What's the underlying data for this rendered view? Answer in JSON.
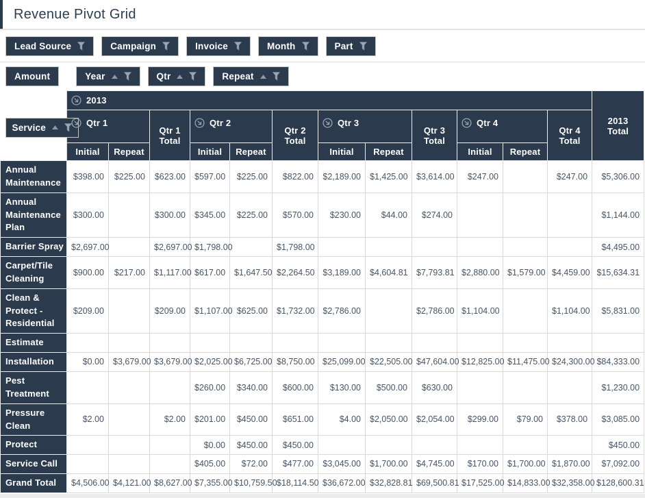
{
  "page": {
    "title": "Revenue Pivot Grid"
  },
  "filter_area": {
    "fields": [
      {
        "label": "Lead Source",
        "icon": "filter-funnel"
      },
      {
        "label": "Campaign",
        "icon": "filter-funnel"
      },
      {
        "label": "Invoice",
        "icon": "filter-funnel"
      },
      {
        "label": "Month",
        "icon": "filter-funnel"
      },
      {
        "label": "Part",
        "icon": "filter-funnel"
      }
    ]
  },
  "data_area": {
    "field": {
      "label": "Amount"
    }
  },
  "column_area": {
    "fields": [
      {
        "label": "Year",
        "sort": "asc",
        "icon": "filter-funnel"
      },
      {
        "label": "Qtr",
        "sort": "asc",
        "icon": "filter-funnel"
      },
      {
        "label": "Repeat",
        "sort": "asc",
        "icon": "filter-funnel"
      }
    ]
  },
  "row_area": {
    "field": {
      "label": "Service",
      "sort": "asc",
      "icon": "filter-funnel"
    }
  },
  "grid": {
    "year": {
      "label": "2013",
      "total_label": "2013 Total",
      "expanded": true
    },
    "quarters": [
      {
        "label": "Qtr 1",
        "total_label": "Qtr 1 Total",
        "expanded": true
      },
      {
        "label": "Qtr 2",
        "total_label": "Qtr 2 Total",
        "expanded": true
      },
      {
        "label": "Qtr 3",
        "total_label": "Qtr 3 Total",
        "expanded": true
      },
      {
        "label": "Qtr 4",
        "total_label": "Qtr 4 Total",
        "expanded": true
      }
    ],
    "subcolumns": [
      "Initial",
      "Repeat"
    ],
    "rows": [
      {
        "label": "Annual Maintenance",
        "values": [
          "$398.00",
          "$225.00",
          "$623.00",
          "$597.00",
          "$225.00",
          "$822.00",
          "$2,189.00",
          "$1,425.00",
          "$3,614.00",
          "$247.00",
          "",
          "$247.00",
          "$5,306.00"
        ]
      },
      {
        "label": "Annual Maintenance Plan",
        "values": [
          "$300.00",
          "",
          "$300.00",
          "$345.00",
          "$225.00",
          "$570.00",
          "$230.00",
          "$44.00",
          "$274.00",
          "",
          "",
          "",
          "$1,144.00"
        ]
      },
      {
        "label": "Barrier Spray",
        "values": [
          "$2,697.00",
          "",
          "$2,697.00",
          "$1,798.00",
          "",
          "$1,798.00",
          "",
          "",
          "",
          "",
          "",
          "",
          "$4,495.00"
        ]
      },
      {
        "label": "Carpet/Tile Cleaning",
        "values": [
          "$900.00",
          "$217.00",
          "$1,117.00",
          "$617.00",
          "$1,647.50",
          "$2,264.50",
          "$3,189.00",
          "$4,604.81",
          "$7,793.81",
          "$2,880.00",
          "$1,579.00",
          "$4,459.00",
          "$15,634.31"
        ]
      },
      {
        "label": "Clean & Protect - Residential",
        "values": [
          "$209.00",
          "",
          "$209.00",
          "$1,107.00",
          "$625.00",
          "$1,732.00",
          "$2,786.00",
          "",
          "$2,786.00",
          "$1,104.00",
          "",
          "$1,104.00",
          "$5,831.00"
        ]
      },
      {
        "label": "Estimate",
        "values": [
          "",
          "",
          "",
          "",
          "",
          "",
          "",
          "",
          "",
          "",
          "",
          "",
          ""
        ]
      },
      {
        "label": "Installation",
        "values": [
          "$0.00",
          "$3,679.00",
          "$3,679.00",
          "$2,025.00",
          "$6,725.00",
          "$8,750.00",
          "$25,099.00",
          "$22,505.00",
          "$47,604.00",
          "$12,825.00",
          "$11,475.00",
          "$24,300.00",
          "$84,333.00"
        ]
      },
      {
        "label": "Pest Treatment",
        "values": [
          "",
          "",
          "",
          "$260.00",
          "$340.00",
          "$600.00",
          "$130.00",
          "$500.00",
          "$630.00",
          "",
          "",
          "",
          "$1,230.00"
        ]
      },
      {
        "label": "Pressure Clean",
        "values": [
          "$2.00",
          "",
          "$2.00",
          "$201.00",
          "$450.00",
          "$651.00",
          "$4.00",
          "$2,050.00",
          "$2,054.00",
          "$299.00",
          "$79.00",
          "$378.00",
          "$3,085.00"
        ]
      },
      {
        "label": "Protect",
        "values": [
          "",
          "",
          "",
          "$0.00",
          "$450.00",
          "$450.00",
          "",
          "",
          "",
          "",
          "",
          "",
          "$450.00"
        ]
      },
      {
        "label": "Service Call",
        "values": [
          "",
          "",
          "",
          "$405.00",
          "$72.00",
          "$477.00",
          "$3,045.00",
          "$1,700.00",
          "$4,745.00",
          "$170.00",
          "$1,700.00",
          "$1,870.00",
          "$7,092.00"
        ]
      },
      {
        "label": "Grand Total",
        "is_grand_total": true,
        "values": [
          "$4,506.00",
          "$4,121.00",
          "$8,627.00",
          "$7,355.00",
          "$10,759.50",
          "$18,114.50",
          "$36,672.00",
          "$32,828.81",
          "$69,500.81",
          "$17,525.00",
          "$14,833.00",
          "$32,358.00",
          "$128,600.31"
        ]
      }
    ]
  },
  "icons": {
    "filter": "funnel",
    "sort_asc": "triangle-up",
    "expanded": "circle-arrow-down-right"
  },
  "colors": {
    "header_navy": "#2b3a4d",
    "title_text": "#2c3e50",
    "cell_text": "#475568",
    "grid_border": "#d9d9d9",
    "icon_gray": "#9aa6b2"
  }
}
